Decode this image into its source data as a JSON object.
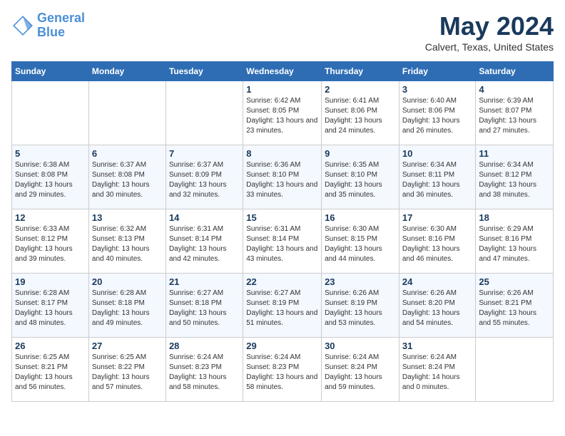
{
  "header": {
    "logo_line1": "General",
    "logo_line2": "Blue",
    "month_year": "May 2024",
    "location": "Calvert, Texas, United States"
  },
  "weekdays": [
    "Sunday",
    "Monday",
    "Tuesday",
    "Wednesday",
    "Thursday",
    "Friday",
    "Saturday"
  ],
  "weeks": [
    [
      {
        "day": "",
        "sunrise": "",
        "sunset": "",
        "daylight": ""
      },
      {
        "day": "",
        "sunrise": "",
        "sunset": "",
        "daylight": ""
      },
      {
        "day": "",
        "sunrise": "",
        "sunset": "",
        "daylight": ""
      },
      {
        "day": "1",
        "sunrise": "Sunrise: 6:42 AM",
        "sunset": "Sunset: 8:05 PM",
        "daylight": "Daylight: 13 hours and 23 minutes."
      },
      {
        "day": "2",
        "sunrise": "Sunrise: 6:41 AM",
        "sunset": "Sunset: 8:06 PM",
        "daylight": "Daylight: 13 hours and 24 minutes."
      },
      {
        "day": "3",
        "sunrise": "Sunrise: 6:40 AM",
        "sunset": "Sunset: 8:06 PM",
        "daylight": "Daylight: 13 hours and 26 minutes."
      },
      {
        "day": "4",
        "sunrise": "Sunrise: 6:39 AM",
        "sunset": "Sunset: 8:07 PM",
        "daylight": "Daylight: 13 hours and 27 minutes."
      }
    ],
    [
      {
        "day": "5",
        "sunrise": "Sunrise: 6:38 AM",
        "sunset": "Sunset: 8:08 PM",
        "daylight": "Daylight: 13 hours and 29 minutes."
      },
      {
        "day": "6",
        "sunrise": "Sunrise: 6:37 AM",
        "sunset": "Sunset: 8:08 PM",
        "daylight": "Daylight: 13 hours and 30 minutes."
      },
      {
        "day": "7",
        "sunrise": "Sunrise: 6:37 AM",
        "sunset": "Sunset: 8:09 PM",
        "daylight": "Daylight: 13 hours and 32 minutes."
      },
      {
        "day": "8",
        "sunrise": "Sunrise: 6:36 AM",
        "sunset": "Sunset: 8:10 PM",
        "daylight": "Daylight: 13 hours and 33 minutes."
      },
      {
        "day": "9",
        "sunrise": "Sunrise: 6:35 AM",
        "sunset": "Sunset: 8:10 PM",
        "daylight": "Daylight: 13 hours and 35 minutes."
      },
      {
        "day": "10",
        "sunrise": "Sunrise: 6:34 AM",
        "sunset": "Sunset: 8:11 PM",
        "daylight": "Daylight: 13 hours and 36 minutes."
      },
      {
        "day": "11",
        "sunrise": "Sunrise: 6:34 AM",
        "sunset": "Sunset: 8:12 PM",
        "daylight": "Daylight: 13 hours and 38 minutes."
      }
    ],
    [
      {
        "day": "12",
        "sunrise": "Sunrise: 6:33 AM",
        "sunset": "Sunset: 8:12 PM",
        "daylight": "Daylight: 13 hours and 39 minutes."
      },
      {
        "day": "13",
        "sunrise": "Sunrise: 6:32 AM",
        "sunset": "Sunset: 8:13 PM",
        "daylight": "Daylight: 13 hours and 40 minutes."
      },
      {
        "day": "14",
        "sunrise": "Sunrise: 6:31 AM",
        "sunset": "Sunset: 8:14 PM",
        "daylight": "Daylight: 13 hours and 42 minutes."
      },
      {
        "day": "15",
        "sunrise": "Sunrise: 6:31 AM",
        "sunset": "Sunset: 8:14 PM",
        "daylight": "Daylight: 13 hours and 43 minutes."
      },
      {
        "day": "16",
        "sunrise": "Sunrise: 6:30 AM",
        "sunset": "Sunset: 8:15 PM",
        "daylight": "Daylight: 13 hours and 44 minutes."
      },
      {
        "day": "17",
        "sunrise": "Sunrise: 6:30 AM",
        "sunset": "Sunset: 8:16 PM",
        "daylight": "Daylight: 13 hours and 46 minutes."
      },
      {
        "day": "18",
        "sunrise": "Sunrise: 6:29 AM",
        "sunset": "Sunset: 8:16 PM",
        "daylight": "Daylight: 13 hours and 47 minutes."
      }
    ],
    [
      {
        "day": "19",
        "sunrise": "Sunrise: 6:28 AM",
        "sunset": "Sunset: 8:17 PM",
        "daylight": "Daylight: 13 hours and 48 minutes."
      },
      {
        "day": "20",
        "sunrise": "Sunrise: 6:28 AM",
        "sunset": "Sunset: 8:18 PM",
        "daylight": "Daylight: 13 hours and 49 minutes."
      },
      {
        "day": "21",
        "sunrise": "Sunrise: 6:27 AM",
        "sunset": "Sunset: 8:18 PM",
        "daylight": "Daylight: 13 hours and 50 minutes."
      },
      {
        "day": "22",
        "sunrise": "Sunrise: 6:27 AM",
        "sunset": "Sunset: 8:19 PM",
        "daylight": "Daylight: 13 hours and 51 minutes."
      },
      {
        "day": "23",
        "sunrise": "Sunrise: 6:26 AM",
        "sunset": "Sunset: 8:19 PM",
        "daylight": "Daylight: 13 hours and 53 minutes."
      },
      {
        "day": "24",
        "sunrise": "Sunrise: 6:26 AM",
        "sunset": "Sunset: 8:20 PM",
        "daylight": "Daylight: 13 hours and 54 minutes."
      },
      {
        "day": "25",
        "sunrise": "Sunrise: 6:26 AM",
        "sunset": "Sunset: 8:21 PM",
        "daylight": "Daylight: 13 hours and 55 minutes."
      }
    ],
    [
      {
        "day": "26",
        "sunrise": "Sunrise: 6:25 AM",
        "sunset": "Sunset: 8:21 PM",
        "daylight": "Daylight: 13 hours and 56 minutes."
      },
      {
        "day": "27",
        "sunrise": "Sunrise: 6:25 AM",
        "sunset": "Sunset: 8:22 PM",
        "daylight": "Daylight: 13 hours and 57 minutes."
      },
      {
        "day": "28",
        "sunrise": "Sunrise: 6:24 AM",
        "sunset": "Sunset: 8:23 PM",
        "daylight": "Daylight: 13 hours and 58 minutes."
      },
      {
        "day": "29",
        "sunrise": "Sunrise: 6:24 AM",
        "sunset": "Sunset: 8:23 PM",
        "daylight": "Daylight: 13 hours and 58 minutes."
      },
      {
        "day": "30",
        "sunrise": "Sunrise: 6:24 AM",
        "sunset": "Sunset: 8:24 PM",
        "daylight": "Daylight: 13 hours and 59 minutes."
      },
      {
        "day": "31",
        "sunrise": "Sunrise: 6:24 AM",
        "sunset": "Sunset: 8:24 PM",
        "daylight": "Daylight: 14 hours and 0 minutes."
      },
      {
        "day": "",
        "sunrise": "",
        "sunset": "",
        "daylight": ""
      }
    ]
  ]
}
